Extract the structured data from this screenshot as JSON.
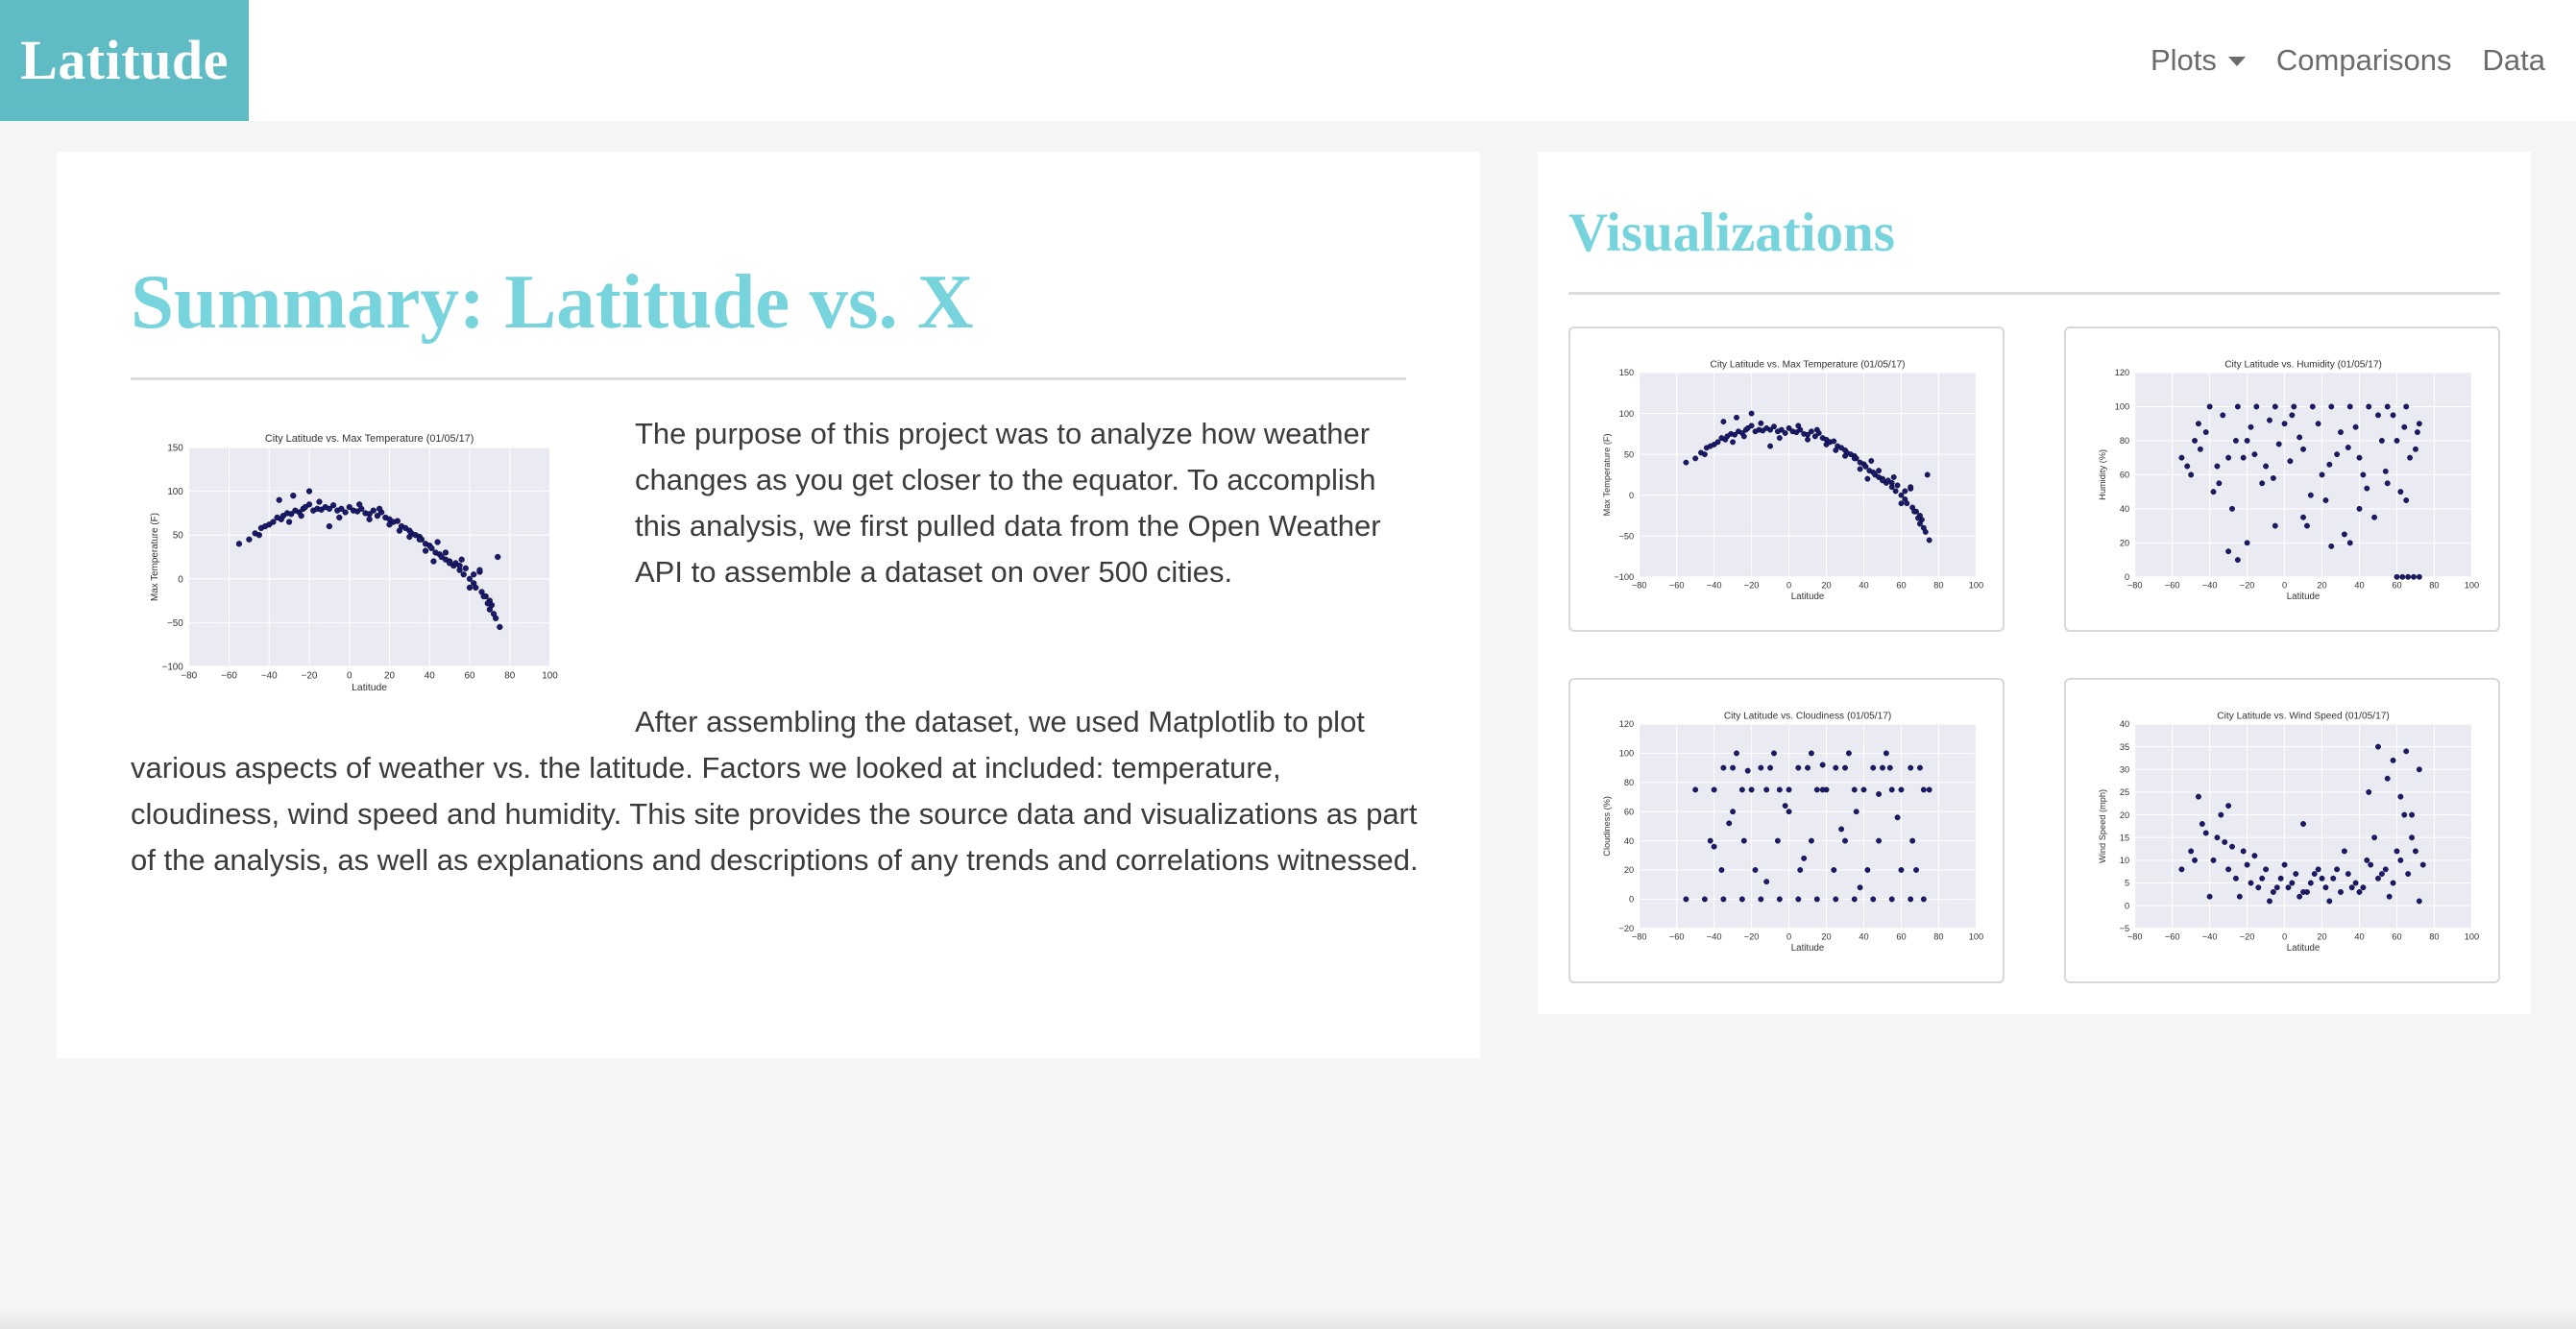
{
  "navbar": {
    "brand": "Latitude",
    "items": [
      {
        "label": "Plots",
        "has_dropdown": true
      },
      {
        "label": "Comparisons",
        "has_dropdown": false
      },
      {
        "label": "Data",
        "has_dropdown": false
      }
    ]
  },
  "summary": {
    "title": "Summary: Latitude vs. X",
    "paragraph1": "The purpose of this project was to analyze how weather changes as you get closer to the equator. To accomplish this analysis, we first pulled data from the Open Weather API to assemble a dataset on over 500 cities.",
    "paragraph2": "After assembling the dataset, we used Matplotlib to plot various aspects of weather vs. the latitude. Factors we looked at included: temperature, cloudiness, wind speed and humidity. This site provides the source data and visualizations as part of the analysis, as well as explanations and descriptions of any trends and correlations witnessed."
  },
  "visualizations": {
    "title": "Visualizations"
  },
  "colors": {
    "brand_bg": "#5fbcc4",
    "heading": "#77d3dc",
    "nav_text": "#6b6b6b",
    "body_text": "#3b3b3b",
    "plot_bg": "#eaeaf2",
    "marker": "#191970"
  },
  "chart_data": [
    {
      "id": "temp-main",
      "type": "scatter",
      "title": "City Latitude vs. Max Temperature (01/05/17)",
      "xlabel": "Latitude",
      "ylabel": "Max Temperature (F)",
      "xlim": [
        -80,
        100
      ],
      "ylim": [
        -100,
        150
      ],
      "xticks": [
        -80,
        -60,
        -40,
        -20,
        0,
        20,
        40,
        60,
        80,
        100
      ],
      "yticks": [
        -100,
        -50,
        0,
        50,
        100,
        150
      ],
      "grid": true,
      "x": [
        -55,
        -50,
        -47,
        -44,
        -42,
        -40,
        -38,
        -36,
        -34,
        -33,
        -31,
        -29,
        -27,
        -25,
        -23,
        -22,
        -20,
        -18,
        -16,
        -14,
        -12,
        -10,
        -8,
        -6,
        -4,
        -2,
        0,
        2,
        4,
        6,
        8,
        10,
        12,
        14,
        16,
        18,
        20,
        22,
        24,
        26,
        28,
        30,
        31,
        33,
        35,
        36,
        38,
        40,
        41,
        43,
        45,
        46,
        48,
        50,
        52,
        53,
        55,
        57,
        58,
        60,
        62,
        63,
        65,
        66,
        68,
        70,
        71,
        73,
        75,
        -45,
        -35,
        -28,
        -20,
        -15,
        -5,
        5,
        15,
        25,
        35,
        42,
        48,
        55,
        60,
        65,
        70,
        72,
        -30,
        -24,
        -10,
        10,
        20,
        30,
        38,
        44,
        50,
        56,
        62,
        67,
        69,
        74
      ],
      "y": [
        40,
        45,
        52,
        58,
        60,
        62,
        65,
        70,
        68,
        72,
        75,
        74,
        78,
        76,
        80,
        82,
        85,
        78,
        80,
        79,
        82,
        80,
        84,
        78,
        80,
        76,
        82,
        78,
        77,
        80,
        75,
        74,
        78,
        72,
        76,
        70,
        68,
        65,
        66,
        60,
        58,
        55,
        52,
        50,
        48,
        45,
        40,
        38,
        35,
        30,
        28,
        25,
        22,
        20,
        15,
        18,
        10,
        5,
        12,
        0,
        -5,
        -10,
        8,
        -15,
        -20,
        -25,
        -30,
        -45,
        -55,
        50,
        90,
        95,
        100,
        88,
        70,
        85,
        80,
        55,
        45,
        20,
        30,
        15,
        -10,
        10,
        -35,
        -40,
        65,
        72,
        60,
        68,
        62,
        48,
        32,
        42,
        18,
        22,
        5,
        -20,
        -28,
        25
      ],
      "marker_color": "#191970"
    },
    {
      "id": "temp-thumb",
      "type": "scatter",
      "title": "City Latitude vs. Max Temperature (01/05/17)",
      "xlabel": "Latitude",
      "ylabel": "Max Temperature (F)",
      "xlim": [
        -80,
        100
      ],
      "ylim": [
        -100,
        150
      ],
      "xticks": [
        -80,
        -60,
        -40,
        -20,
        0,
        20,
        40,
        60,
        80,
        100
      ],
      "yticks": [
        -100,
        -50,
        0,
        50,
        100,
        150
      ],
      "grid": true,
      "x": [
        -55,
        -50,
        -47,
        -44,
        -42,
        -40,
        -38,
        -36,
        -34,
        -33,
        -31,
        -29,
        -27,
        -25,
        -23,
        -22,
        -20,
        -18,
        -16,
        -14,
        -12,
        -10,
        -8,
        -6,
        -4,
        -2,
        0,
        2,
        4,
        6,
        8,
        10,
        12,
        14,
        16,
        18,
        20,
        22,
        24,
        26,
        28,
        30,
        31,
        33,
        35,
        36,
        38,
        40,
        41,
        43,
        45,
        46,
        48,
        50,
        52,
        53,
        55,
        57,
        58,
        60,
        62,
        63,
        65,
        66,
        68,
        70,
        71,
        73,
        75,
        -45,
        -35,
        -28,
        -20,
        -15,
        -5,
        5,
        15,
        25,
        35,
        42,
        48,
        55,
        60,
        65,
        70,
        72,
        -30,
        -24,
        -10,
        10,
        20,
        30,
        38,
        44,
        50,
        56,
        62,
        67,
        69,
        74
      ],
      "y": [
        40,
        45,
        52,
        58,
        60,
        62,
        65,
        70,
        68,
        72,
        75,
        74,
        78,
        76,
        80,
        82,
        85,
        78,
        80,
        79,
        82,
        80,
        84,
        78,
        80,
        76,
        82,
        78,
        77,
        80,
        75,
        74,
        78,
        72,
        76,
        70,
        68,
        65,
        66,
        60,
        58,
        55,
        52,
        50,
        48,
        45,
        40,
        38,
        35,
        30,
        28,
        25,
        22,
        20,
        15,
        18,
        10,
        5,
        12,
        0,
        -5,
        -10,
        8,
        -15,
        -20,
        -25,
        -30,
        -45,
        -55,
        50,
        90,
        95,
        100,
        88,
        70,
        85,
        80,
        55,
        45,
        20,
        30,
        15,
        -10,
        10,
        -35,
        -40,
        65,
        72,
        60,
        68,
        62,
        48,
        32,
        42,
        18,
        22,
        5,
        -20,
        -28,
        25
      ],
      "marker_color": "#191970"
    },
    {
      "id": "humidity-thumb",
      "type": "scatter",
      "title": "City Latitude vs. Humidity (01/05/17)",
      "xlabel": "Latitude",
      "ylabel": "Humidity (%)",
      "xlim": [
        -80,
        100
      ],
      "ylim": [
        0,
        120
      ],
      "xticks": [
        -80,
        -60,
        -40,
        -20,
        0,
        20,
        40,
        60,
        80,
        100
      ],
      "yticks": [
        0,
        20,
        40,
        60,
        80,
        100,
        120
      ],
      "grid": true,
      "x": [
        -50,
        -45,
        -40,
        -35,
        -30,
        -25,
        -20,
        -15,
        -10,
        -5,
        0,
        5,
        10,
        15,
        20,
        25,
        30,
        35,
        40,
        45,
        50,
        55,
        60,
        65,
        70,
        72,
        -42,
        -38,
        -33,
        -28,
        -22,
        -18,
        -12,
        -8,
        -3,
        3,
        8,
        12,
        18,
        22,
        28,
        32,
        38,
        42,
        48,
        52,
        58,
        62,
        67,
        71,
        -30,
        -20,
        -5,
        10,
        25,
        40,
        55,
        65,
        -46,
        -36,
        -26,
        -16,
        -6,
        4,
        14,
        24,
        34,
        44,
        54,
        64,
        60,
        63,
        66,
        69,
        72,
        -55,
        -52,
        -48,
        -25,
        35
      ],
      "y": [
        60,
        75,
        100,
        55,
        70,
        100,
        80,
        100,
        65,
        100,
        90,
        100,
        75,
        100,
        60,
        100,
        85,
        100,
        70,
        100,
        95,
        100,
        80,
        100,
        75,
        90,
        85,
        50,
        95,
        40,
        70,
        88,
        55,
        92,
        78,
        68,
        82,
        30,
        90,
        45,
        72,
        25,
        88,
        60,
        35,
        80,
        95,
        50,
        70,
        85,
        15,
        20,
        30,
        35,
        18,
        40,
        55,
        45,
        90,
        65,
        80,
        72,
        58,
        95,
        48,
        66,
        76,
        52,
        62,
        88,
        0,
        0,
        0,
        0,
        0,
        70,
        65,
        80,
        10,
        20
      ],
      "marker_color": "#191970"
    },
    {
      "id": "cloudiness-thumb",
      "type": "scatter",
      "title": "City Latitude vs. Cloudiness (01/05/17)",
      "xlabel": "Latitude",
      "ylabel": "Cloudiness (%)",
      "xlim": [
        -80,
        100
      ],
      "ylim": [
        -20,
        120
      ],
      "xticks": [
        -80,
        -60,
        -40,
        -20,
        0,
        20,
        40,
        60,
        80,
        100
      ],
      "yticks": [
        -20,
        0,
        20,
        40,
        60,
        80,
        100,
        120
      ],
      "grid": true,
      "x": [
        -55,
        -50,
        -45,
        -40,
        -35,
        -30,
        -25,
        -20,
        -15,
        -10,
        -5,
        0,
        5,
        10,
        15,
        20,
        25,
        30,
        35,
        40,
        45,
        50,
        55,
        60,
        65,
        70,
        -42,
        -36,
        -30,
        -24,
        -18,
        -12,
        -6,
        0,
        6,
        12,
        18,
        24,
        30,
        36,
        42,
        48,
        54,
        60,
        66,
        72,
        -40,
        -32,
        -22,
        -12,
        -2,
        8,
        18,
        28,
        38,
        48,
        58,
        68,
        -35,
        -25,
        -15,
        -5,
        5,
        15,
        25,
        35,
        45,
        55,
        65,
        75,
        -28,
        -8,
        12,
        32,
        52,
        72
      ],
      "y": [
        0,
        75,
        0,
        75,
        0,
        90,
        0,
        75,
        0,
        90,
        0,
        75,
        0,
        90,
        0,
        75,
        0,
        90,
        0,
        75,
        0,
        90,
        0,
        75,
        0,
        90,
        40,
        20,
        60,
        40,
        20,
        75,
        40,
        60,
        20,
        40,
        75,
        20,
        40,
        60,
        20,
        40,
        90,
        20,
        40,
        75,
        36,
        52,
        88,
        12,
        64,
        28,
        92,
        48,
        8,
        72,
        56,
        20,
        90,
        75,
        90,
        75,
        90,
        75,
        90,
        75,
        90,
        75,
        90,
        75,
        100,
        100,
        100,
        100,
        100,
        0
      ],
      "marker_color": "#191970"
    },
    {
      "id": "wind-thumb",
      "type": "scatter",
      "title": "City Latitude vs. Wind Speed (01/05/17)",
      "xlabel": "Latitude",
      "ylabel": "Wind Speed (mph)",
      "xlim": [
        -80,
        100
      ],
      "ylim": [
        -5,
        40
      ],
      "xticks": [
        -80,
        -60,
        -40,
        -20,
        0,
        20,
        40,
        60,
        80,
        100
      ],
      "yticks": [
        -5,
        0,
        5,
        10,
        15,
        20,
        25,
        30,
        35,
        40
      ],
      "grid": true,
      "x": [
        -55,
        -50,
        -46,
        -42,
        -38,
        -34,
        -30,
        -26,
        -22,
        -18,
        -14,
        -10,
        -6,
        -2,
        2,
        6,
        10,
        14,
        18,
        22,
        26,
        30,
        34,
        38,
        42,
        46,
        50,
        54,
        58,
        62,
        66,
        70,
        74,
        -44,
        -36,
        -28,
        -20,
        -12,
        -4,
        4,
        12,
        20,
        28,
        36,
        44,
        52,
        60,
        68,
        -40,
        -24,
        -8,
        8,
        24,
        40,
        56,
        72,
        -48,
        -32,
        -16,
        0,
        16,
        32,
        48,
        64,
        -30,
        10,
        45,
        55,
        62,
        68,
        72,
        50,
        58,
        65
      ],
      "y": [
        8,
        12,
        24,
        16,
        10,
        20,
        8,
        6,
        12,
        5,
        4,
        8,
        3,
        6,
        4,
        7,
        3,
        5,
        8,
        4,
        6,
        3,
        7,
        5,
        4,
        9,
        6,
        8,
        5,
        10,
        7,
        12,
        9,
        18,
        15,
        13,
        9,
        6,
        4,
        5,
        3,
        6,
        8,
        4,
        10,
        7,
        12,
        15,
        2,
        2,
        1,
        2,
        1,
        3,
        2,
        1,
        10,
        14,
        11,
        9,
        7,
        12,
        15,
        20,
        22,
        18,
        25,
        28,
        24,
        20,
        30,
        35,
        32,
        34
      ],
      "marker_color": "#191970"
    }
  ]
}
